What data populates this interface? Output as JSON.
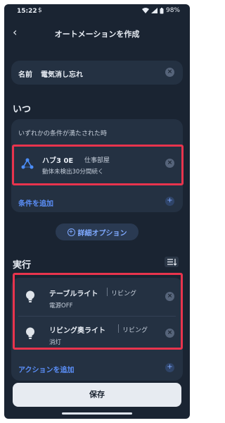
{
  "status": {
    "time": "15:22",
    "battery": "98%",
    "sim_icon": "$"
  },
  "header": {
    "title": "オートメーションを作成",
    "back_icon": "chevron-left-icon"
  },
  "name_field": {
    "label": "名前",
    "value": "電気消し忘れ"
  },
  "when": {
    "title": "いつ",
    "condition_header": "いずれかの条件が満たされた時",
    "conditions": [
      {
        "device": "ハブ3 0E",
        "room": "仕事部屋",
        "detail": "動体未検出30分間続く",
        "icon": "hub-icon"
      }
    ],
    "add_label": "条件を追加"
  },
  "detail_options": {
    "label": "詳細オプション"
  },
  "execute": {
    "title": "実行",
    "actions": [
      {
        "device": "テーブルライト",
        "room": "リビング",
        "detail": "電源OFF",
        "icon": "bulb-icon"
      },
      {
        "device": "リビング奥ライト",
        "room": "リビング",
        "detail": "消灯",
        "icon": "bulb-icon"
      }
    ],
    "add_label": "アクションを追加"
  },
  "save_label": "保存",
  "colors": {
    "background": "#1a2432",
    "card": "#243142",
    "accent": "#5b8ff9",
    "highlight": "#e8344d"
  }
}
